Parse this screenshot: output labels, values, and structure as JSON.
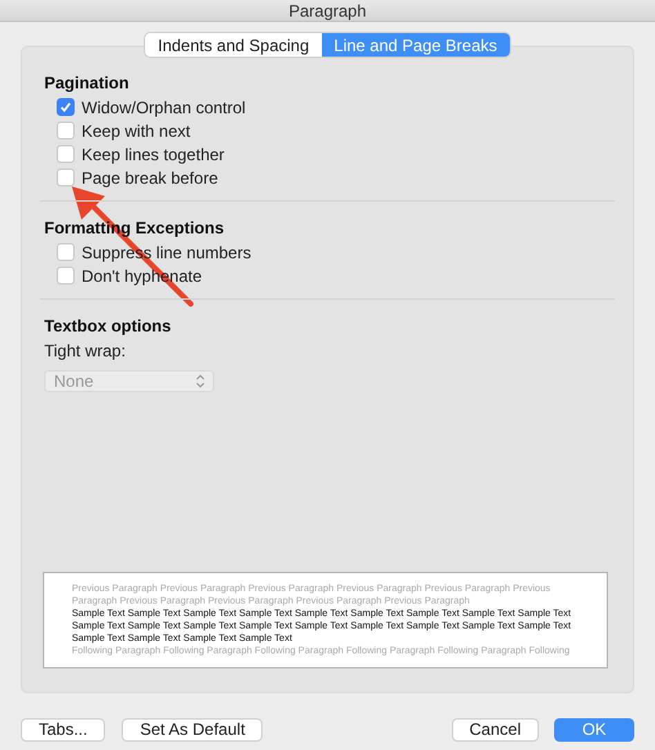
{
  "window": {
    "title": "Paragraph"
  },
  "tabs": [
    {
      "label": "Indents and Spacing",
      "selected": false
    },
    {
      "label": "Line and Page Breaks",
      "selected": true
    }
  ],
  "sections": [
    {
      "kind": "checks",
      "title": "Pagination",
      "items": [
        {
          "label": "Widow/Orphan control",
          "checked": true
        },
        {
          "label": "Keep with next",
          "checked": false
        },
        {
          "label": "Keep lines together",
          "checked": false
        },
        {
          "label": "Page break before",
          "checked": false
        }
      ]
    },
    {
      "kind": "checks",
      "title": "Formatting Exceptions",
      "items": [
        {
          "label": "Suppress line numbers",
          "checked": false
        },
        {
          "label": "Don't hyphenate",
          "checked": false
        }
      ]
    },
    {
      "kind": "select",
      "title": "Textbox options",
      "label": "Tight wrap:",
      "value": "None",
      "disabled": true
    }
  ],
  "preview": [
    {
      "kind": "previous",
      "text": "Previous Paragraph Previous Paragraph Previous Paragraph Previous Paragraph Previous Paragraph Previous"
    },
    {
      "kind": "previous",
      "text": "Paragraph Previous Paragraph Previous Paragraph Previous Paragraph Previous Paragraph"
    },
    {
      "kind": "sample",
      "text": "Sample Text Sample Text Sample Text Sample Text Sample Text Sample Text Sample Text Sample Text Sample Text"
    },
    {
      "kind": "sample",
      "text": "Sample Text Sample Text Sample Text Sample Text Sample Text Sample Text Sample Text Sample Text Sample Text"
    },
    {
      "kind": "sample",
      "text": "Sample Text Sample Text Sample Text Sample Text"
    },
    {
      "kind": "following",
      "text": "Following Paragraph Following Paragraph Following Paragraph Following Paragraph Following Paragraph Following"
    }
  ],
  "buttons": [
    {
      "label": "Tabs...",
      "kind": "plain"
    },
    {
      "label": "Set As Default",
      "kind": "plain"
    },
    {
      "label": "Cancel",
      "kind": "plain"
    },
    {
      "label": "OK",
      "kind": "primary"
    }
  ]
}
